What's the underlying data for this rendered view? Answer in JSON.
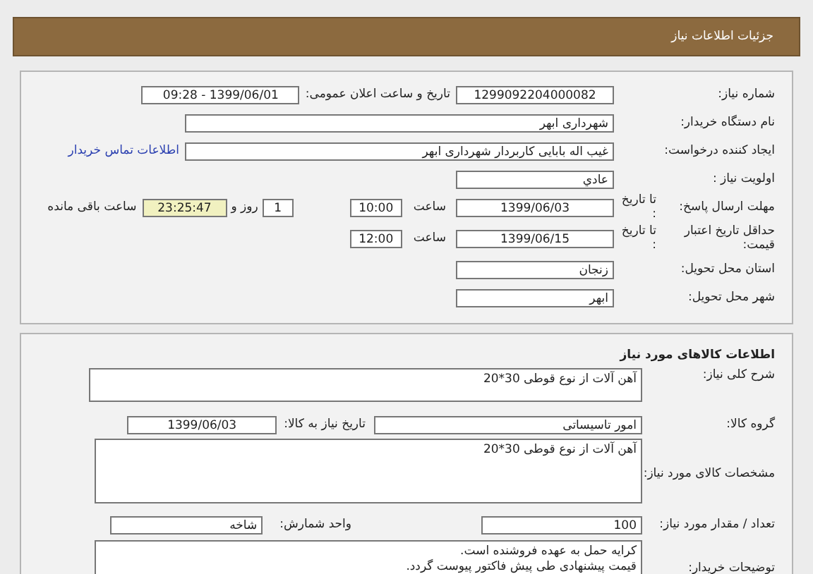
{
  "title": "جزئیات اطلاعات نیاز",
  "need": {
    "need_number": {
      "label": "شماره نیاز:",
      "value": "1299092204000082"
    },
    "announce": {
      "label": "تاریخ و ساعت اعلان عمومی:",
      "value": "1399/06/01 - 09:28"
    },
    "buyer_org": {
      "label": "نام دستگاه خریدار:",
      "value": "شهرداری ابهر"
    },
    "requester": {
      "label": "ایجاد کننده درخواست:",
      "value": "غیب اله  بابایی  کاربردار  شهرداری ابهر",
      "link": "اطلاعات تماس خریدار"
    },
    "priority": {
      "label": "اولویت نیاز :",
      "value": "عادي"
    },
    "response_deadline": {
      "label": "مهلت ارسال پاسخ:",
      "to_date_label": "تا تاریخ :",
      "date": "1399/06/03",
      "time_label": "ساعت",
      "time": "10:00",
      "days": "1",
      "days_label": "روز و",
      "remaining": "23:25:47",
      "remaining_label": "ساعت باقی مانده"
    },
    "price_validity": {
      "label": "حداقل تاریخ اعتبار قیمت:",
      "to_date_label": "تا تاریخ :",
      "date": "1399/06/15",
      "time_label": "ساعت",
      "time": "12:00"
    },
    "province": {
      "label": "استان محل تحویل:",
      "value": "زنجان"
    },
    "city": {
      "label": "شهر محل تحویل:",
      "value": "ابهر"
    }
  },
  "goods": {
    "title": "اطلاعات کالاهای مورد نیاز",
    "general_desc": {
      "label": "شرح کلی نیاز:",
      "value": "آهن آلات از نوع قوطی 30*20"
    },
    "group": {
      "label": "گروه کالا:",
      "value": "امور تاسیساتی"
    },
    "need_date": {
      "label": "تاریخ نیاز به کالا:",
      "value": "1399/06/03"
    },
    "specs": {
      "label": "مشخصات کالای مورد نیاز:",
      "value": "آهن آلات از نوع قوطی 30*20"
    },
    "quantity": {
      "label": "تعداد / مقدار مورد نیاز:",
      "value": "100"
    },
    "unit": {
      "label": "واحد شمارش:",
      "value": "شاخه"
    },
    "notes": {
      "label": "توضیحات خریدار:",
      "lines": [
        "کرایه حمل به عهده فروشنده است.",
        "قیمت پیشنهادی طی پیش فاکتور پیوست گردد."
      ]
    }
  }
}
